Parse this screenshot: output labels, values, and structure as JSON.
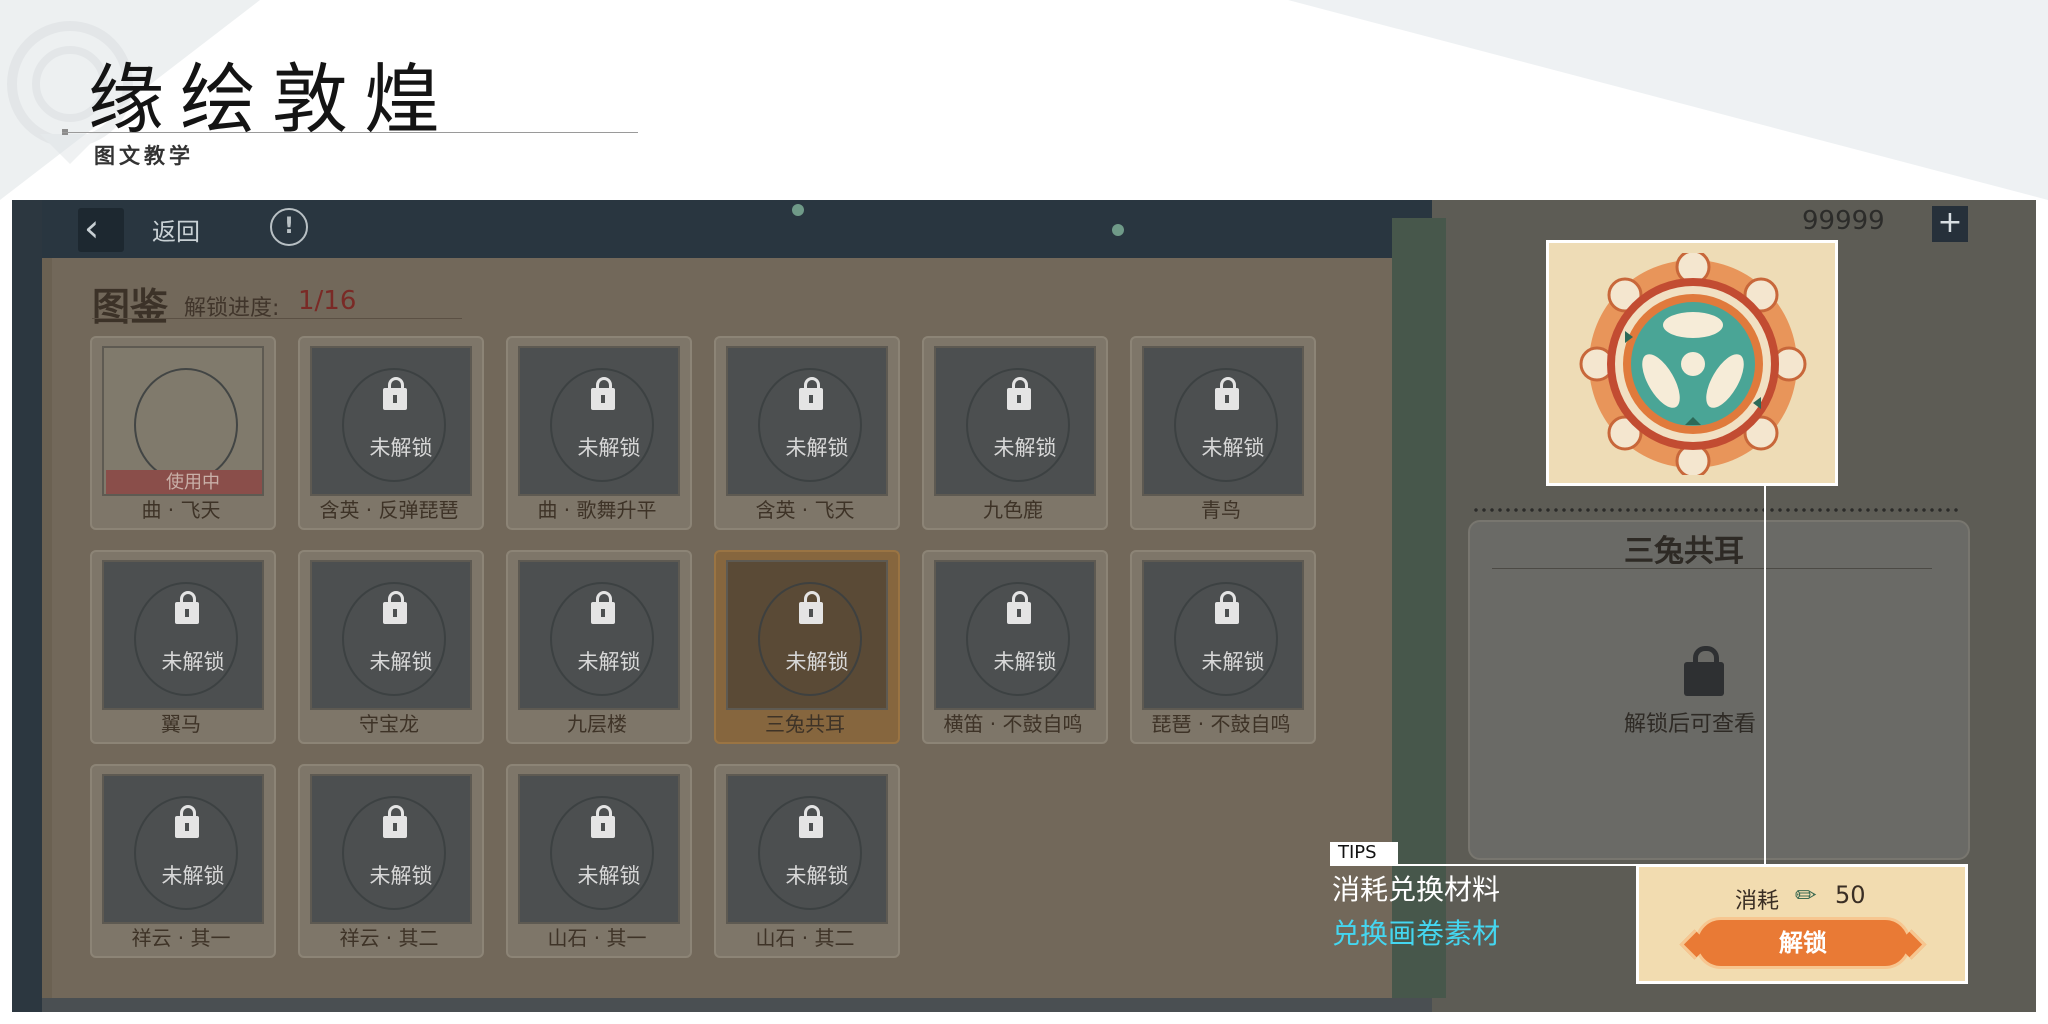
{
  "header": {
    "title": "缘绘敦煌",
    "subtitle": "图文教学"
  },
  "game": {
    "back_label": "返回",
    "info_icon": "info-icon",
    "collection_title": "图鉴",
    "progress_label": "解锁进度:",
    "progress_value": "1/16",
    "currency_amount": "99999",
    "plus_label": "+",
    "cards": [
      {
        "name": "曲 · 飞天",
        "locked": false,
        "status": "使用中"
      },
      {
        "name": "含英 · 反弹琵琶",
        "locked": true,
        "status": "未解锁"
      },
      {
        "name": "曲 · 歌舞升平",
        "locked": true,
        "status": "未解锁"
      },
      {
        "name": "含英 · 飞天",
        "locked": true,
        "status": "未解锁"
      },
      {
        "name": "九色鹿",
        "locked": true,
        "status": "未解锁"
      },
      {
        "name": "青鸟",
        "locked": true,
        "status": "未解锁"
      },
      {
        "name": "翼马",
        "locked": true,
        "status": "未解锁"
      },
      {
        "name": "守宝龙",
        "locked": true,
        "status": "未解锁"
      },
      {
        "name": "九层楼",
        "locked": true,
        "status": "未解锁"
      },
      {
        "name": "三兔共耳",
        "locked": true,
        "status": "未解锁",
        "selected": true
      },
      {
        "name": "横笛 · 不鼓自鸣",
        "locked": true,
        "status": "未解锁"
      },
      {
        "name": "琵琶 · 不鼓自鸣",
        "locked": true,
        "status": "未解锁"
      },
      {
        "name": "祥云 · 其一",
        "locked": true,
        "status": "未解锁"
      },
      {
        "name": "祥云 · 其二",
        "locked": true,
        "status": "未解锁"
      },
      {
        "name": "山石 · 其一",
        "locked": true,
        "status": "未解锁"
      },
      {
        "name": "山石 · 其二",
        "locked": true,
        "status": "未解锁"
      }
    ],
    "detail": {
      "title": "三兔共耳",
      "locked_hint": "解锁后可查看"
    },
    "unlock_panel": {
      "cost_label": "消耗",
      "cost_icon": "brush-icon",
      "cost_value": "50",
      "button_label": "解锁"
    }
  },
  "callout": {
    "tag": "TIPS",
    "line1": "消耗兑换材料",
    "line2": "兑换画卷素材"
  },
  "colors": {
    "tips_highlight": "#44d6f0",
    "unlock_button": "#e97a35",
    "progress_value": "#7a2a26"
  }
}
